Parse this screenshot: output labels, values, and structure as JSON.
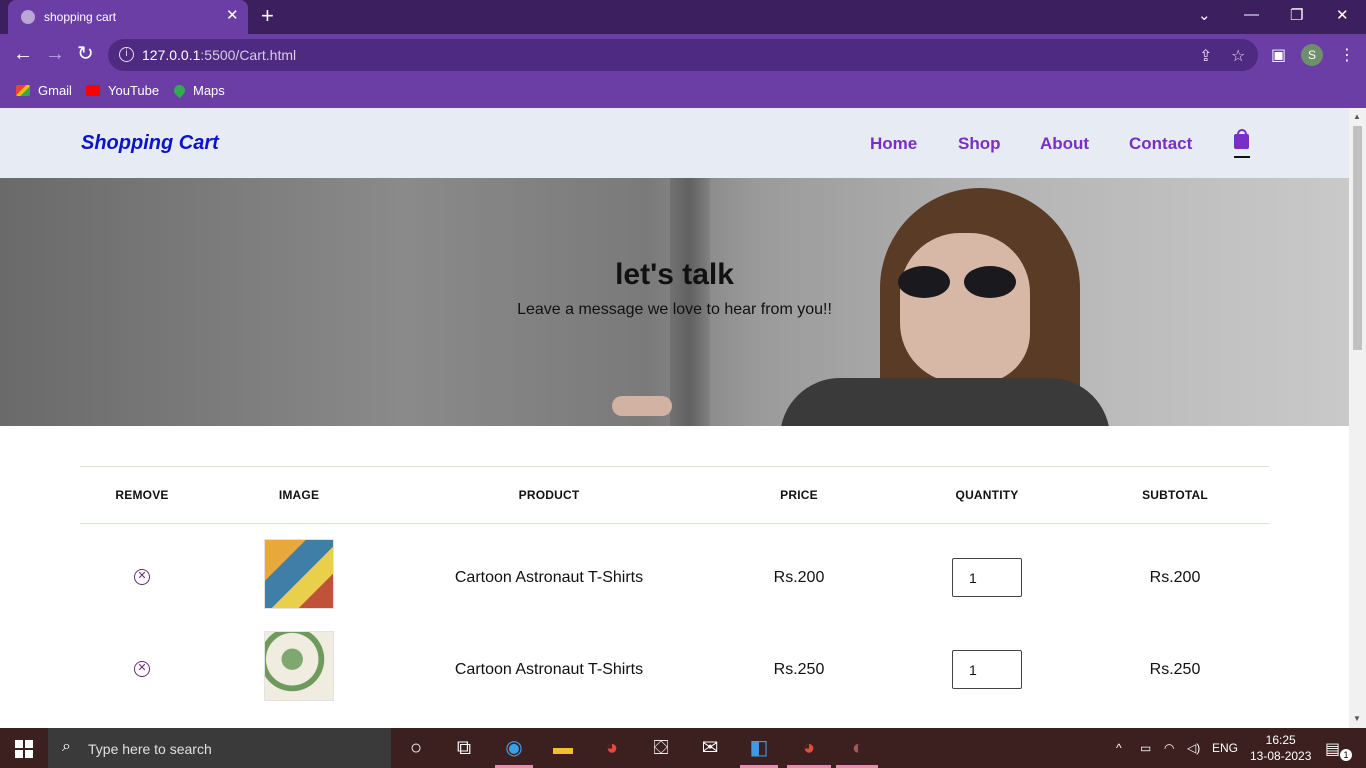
{
  "browser": {
    "tab_title": "shopping cart",
    "tab_close": "✕",
    "new_tab": "+",
    "window_controls": {
      "minimize": "—",
      "restore": "❐",
      "close": "✕",
      "tabsearch": "⌄"
    },
    "url_host": "127.0.0.1",
    "url_path": ":5500/Cart.html",
    "profile_initial": "S",
    "bookmarks": [
      {
        "label": "Gmail",
        "icon": "gmail-icon"
      },
      {
        "label": "YouTube",
        "icon": "youtube-icon"
      },
      {
        "label": "Maps",
        "icon": "maps-icon"
      }
    ]
  },
  "site": {
    "logo": "Shopping Cart",
    "nav": [
      "Home",
      "Shop",
      "About",
      "Contact"
    ],
    "hero_title": "let's talk",
    "hero_subtitle": "Leave a message we love to hear from you!!"
  },
  "cart": {
    "headers": [
      "REMOVE",
      "IMAGE",
      "PRODUCT",
      "PRICE",
      "QUANTITY",
      "SUBTOTAL"
    ],
    "rows": [
      {
        "product": "Cartoon Astronaut T-Shirts",
        "price": "Rs.200",
        "quantity": "1",
        "subtotal": "Rs.200"
      },
      {
        "product": "Cartoon Astronaut T-Shirts",
        "price": "Rs.250",
        "quantity": "1",
        "subtotal": "Rs.250"
      }
    ]
  },
  "taskbar": {
    "search_placeholder": "Type here to search",
    "language": "ENG",
    "time": "16:25",
    "date": "13-08-2023",
    "notification_count": "1"
  },
  "colors": {
    "accent": "#7a2fc4",
    "logo": "#0b14c8",
    "chrome": "#6b3ea6"
  }
}
